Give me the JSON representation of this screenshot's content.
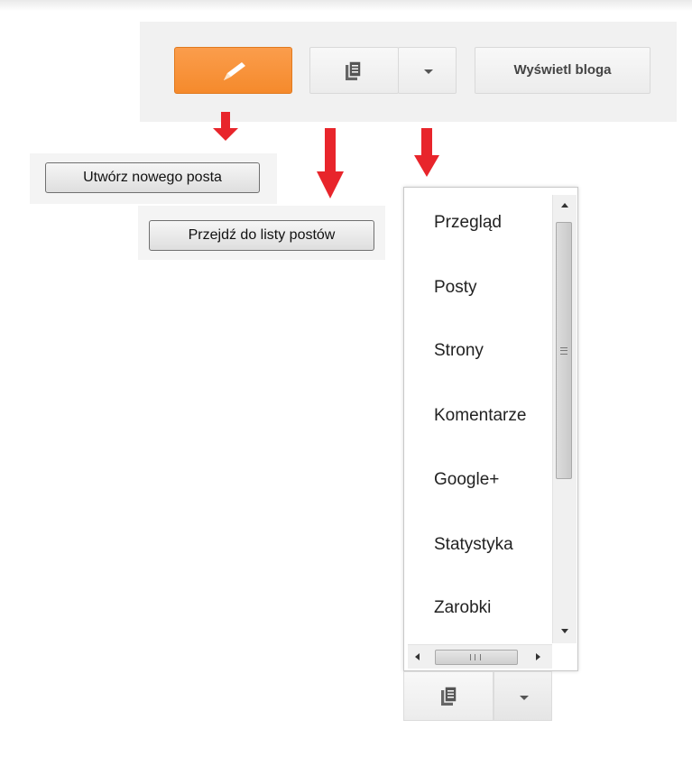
{
  "toolbar": {
    "new_post_icon": "pencil-icon",
    "posts_icon": "document-stack-icon",
    "dropdown_icon": "caret-down-icon",
    "view_blog_label": "Wyświetl bloga",
    "accent_color": "#f58a2c"
  },
  "tooltips": {
    "new_post": "Utwórz nowego posta",
    "post_list": "Przejdź do listy postów"
  },
  "menu": {
    "items": [
      {
        "label": "Przegląd"
      },
      {
        "label": "Posty"
      },
      {
        "label": "Strony"
      },
      {
        "label": "Komentarze"
      },
      {
        "label": "Google+"
      },
      {
        "label": "Statystyka"
      },
      {
        "label": "Zarobki"
      }
    ]
  },
  "arrow_color": "#e8252b"
}
